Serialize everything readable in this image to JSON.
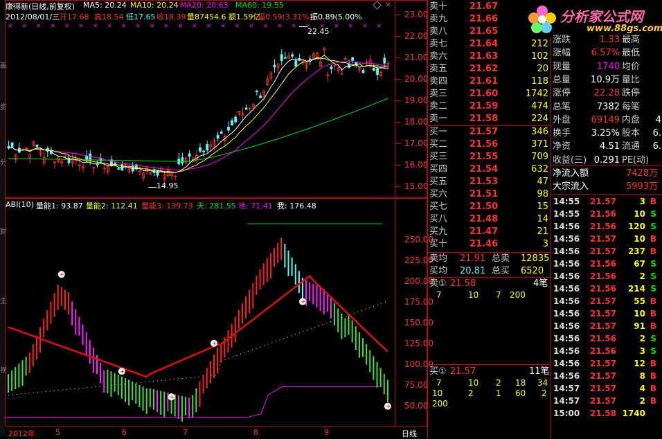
{
  "price_header": {
    "name": "康得新(日线,前复权)",
    "ma5": "MA5: 20.24",
    "ma10": "MA10: 20.24",
    "ma20": "MA20: 20.63",
    "ma60": "MA60: 19.55",
    "date": "2012/08/01/三",
    "open": "开17.68",
    "high": "高18.54",
    "low": "低17.65",
    "close": "收18.39",
    "volume": "量87454.6",
    "amount": "额1.59亿",
    "change": "幅0.59(3.31%)",
    "amplitude": "振0.89(5.00%"
  },
  "price_annotations": {
    "high": "22.45",
    "low": "14.95"
  },
  "price_axis": [
    "23.00",
    "22.00",
    "21.00",
    "20.00",
    "19.00",
    "18.00",
    "17.00",
    "16.00",
    "15.00"
  ],
  "indicator_header": {
    "name": "ABI(10)",
    "l1": "量能1: 93.87",
    "l2": "量能2: 112.41",
    "l3": "量能3: 139.73",
    "tian": "天: 281.55",
    "di": "地: 71.41",
    "wo": "我: 176.48"
  },
  "indicator_axis": [
    "250.00",
    "225.00",
    "200.00",
    "175.00",
    "150.00",
    "125.00",
    "100.00",
    "75.00",
    "50.00"
  ],
  "time_axis": {
    "year": "2012年",
    "m5": "5",
    "m6": "6",
    "m7": "7",
    "m8": "8",
    "m9": "9",
    "period": "日线"
  },
  "colors": {
    "up": "#ff3232",
    "down": "#54fcfc",
    "ma5": "#ffffff",
    "ma10": "#ffff00",
    "ma20": "#ff00ff",
    "ma60": "#00e000"
  },
  "order_book": {
    "asks": [
      {
        "label": "卖十",
        "price": "21.67",
        "vol": ""
      },
      {
        "label": "卖九",
        "price": "21.66",
        "vol": ""
      },
      {
        "label": "卖八",
        "price": "21.65",
        "vol": ""
      },
      {
        "label": "卖七",
        "price": "21.64",
        "vol": "212"
      },
      {
        "label": "卖六",
        "price": "21.63",
        "vol": "102"
      },
      {
        "label": "卖五",
        "price": "21.62",
        "vol": "20"
      },
      {
        "label": "卖四",
        "price": "21.61",
        "vol": "118"
      },
      {
        "label": "卖三",
        "price": "21.60",
        "vol": "1742"
      },
      {
        "label": "卖二",
        "price": "21.59",
        "vol": "474"
      },
      {
        "label": "卖一",
        "price": "21.58",
        "vol": "224"
      }
    ],
    "bids": [
      {
        "label": "买一",
        "price": "21.57",
        "vol": "346"
      },
      {
        "label": "买二",
        "price": "21.56",
        "vol": "371"
      },
      {
        "label": "买三",
        "price": "21.55",
        "vol": "709"
      },
      {
        "label": "买四",
        "price": "21.54",
        "vol": "632"
      },
      {
        "label": "买五",
        "price": "21.53",
        "vol": "47"
      },
      {
        "label": "买六",
        "price": "21.51",
        "vol": "98"
      },
      {
        "label": "买七",
        "price": "21.50",
        "vol": "15"
      },
      {
        "label": "买八",
        "price": "21.48",
        "vol": "14"
      },
      {
        "label": "买九",
        "price": "21.47",
        "vol": "21"
      },
      {
        "label": "买十",
        "price": "21.46",
        "vol": "3"
      }
    ],
    "ask_avg_label": "卖均",
    "ask_avg": "21.91",
    "total_ask_label": "总卖",
    "total_ask": "12835",
    "bid_avg_label": "买均",
    "bid_avg": "20.81",
    "total_bid_label": "总买",
    "total_bid": "6520",
    "sell1_queue": {
      "label": "卖①",
      "price": "21.58",
      "count": "4笔",
      "orders": [
        "7",
        "10",
        "7",
        "200"
      ]
    },
    "buy1_queue": {
      "label": "买①",
      "price": "21.57",
      "count": "11笔",
      "orders": [
        [
          "7",
          "10",
          "2",
          "18",
          "34"
        ],
        [
          "10",
          "2",
          "1",
          "60",
          "2"
        ],
        [
          "200"
        ]
      ]
    }
  },
  "ad": {
    "text": "分析家公式网",
    "url": "www.88gs.com"
  },
  "quote": {
    "rows": [
      {
        "k1": "涨跌",
        "v1": "1.33",
        "k2": "最高",
        "v2": ""
      },
      {
        "k1": "涨幅",
        "v1": "6.57%",
        "k2": "最低",
        "v2": ""
      },
      {
        "k1": "现量",
        "v1": "1740",
        "k2": "均价",
        "v2": ""
      },
      {
        "k1": "总量",
        "v1": "10.9万",
        "k2": "量比",
        "v2": ""
      },
      {
        "k1": "涨停",
        "v1": "22.28",
        "k2": "跌停",
        "v2": ""
      },
      {
        "k1": "总笔",
        "v1": "7382",
        "k2": "每笔",
        "v2": ""
      },
      {
        "k1": "外盘",
        "v1": "69149",
        "k2": "内盘",
        "v2": "4"
      },
      {
        "k1": "换手",
        "v1": "3.25%",
        "k2": "股本",
        "v2": "6."
      },
      {
        "k1": "净资",
        "v1": "4.51",
        "k2": "流通",
        "v2": "6."
      },
      {
        "k1": "收益(三)",
        "v1": "0.291",
        "k2": "PE(动)",
        "v2": ""
      }
    ],
    "net_inflow_label": "净流入额",
    "net_inflow": "7428万",
    "block_inflow_label": "大宗流入",
    "block_inflow": "5993万"
  },
  "ticks": [
    {
      "t": "14:55",
      "p": "21.57",
      "v": "3",
      "s": "B"
    },
    {
      "t": "14:55",
      "p": "21.56",
      "v": "10",
      "s": "S"
    },
    {
      "t": "14:56",
      "p": "21.56",
      "v": "120",
      "s": "S"
    },
    {
      "t": "14:56",
      "p": "21.57",
      "v": "10",
      "s": "B"
    },
    {
      "t": "14:56",
      "p": "21.57",
      "v": "237",
      "s": "B"
    },
    {
      "t": "14:56",
      "p": "21.56",
      "v": "67",
      "s": "S"
    },
    {
      "t": "14:56",
      "p": "21.56",
      "v": "2",
      "s": "S"
    },
    {
      "t": "14:56",
      "p": "21.56",
      "v": "214",
      "s": "S"
    },
    {
      "t": "14:56",
      "p": "21.57",
      "v": "55",
      "s": "B"
    },
    {
      "t": "14:56",
      "p": "21.57",
      "v": "10",
      "s": "B"
    },
    {
      "t": "14:56",
      "p": "21.57",
      "v": "91",
      "s": "B"
    },
    {
      "t": "14:56",
      "p": "21.56",
      "v": "2",
      "s": "S"
    },
    {
      "t": "14:56",
      "p": "21.56",
      "v": "3",
      "s": "S"
    },
    {
      "t": "14:56",
      "p": "21.57",
      "v": "12",
      "s": "B"
    },
    {
      "t": "14:56",
      "p": "21.57",
      "v": "8",
      "s": "B"
    },
    {
      "t": "14:57",
      "p": "21.57",
      "v": "4",
      "s": "B"
    },
    {
      "t": "14:57",
      "p": "21.57",
      "v": "2",
      "s": "B"
    },
    {
      "t": "15:00",
      "p": "21.58",
      "v": "1740",
      "s": ""
    }
  ]
}
